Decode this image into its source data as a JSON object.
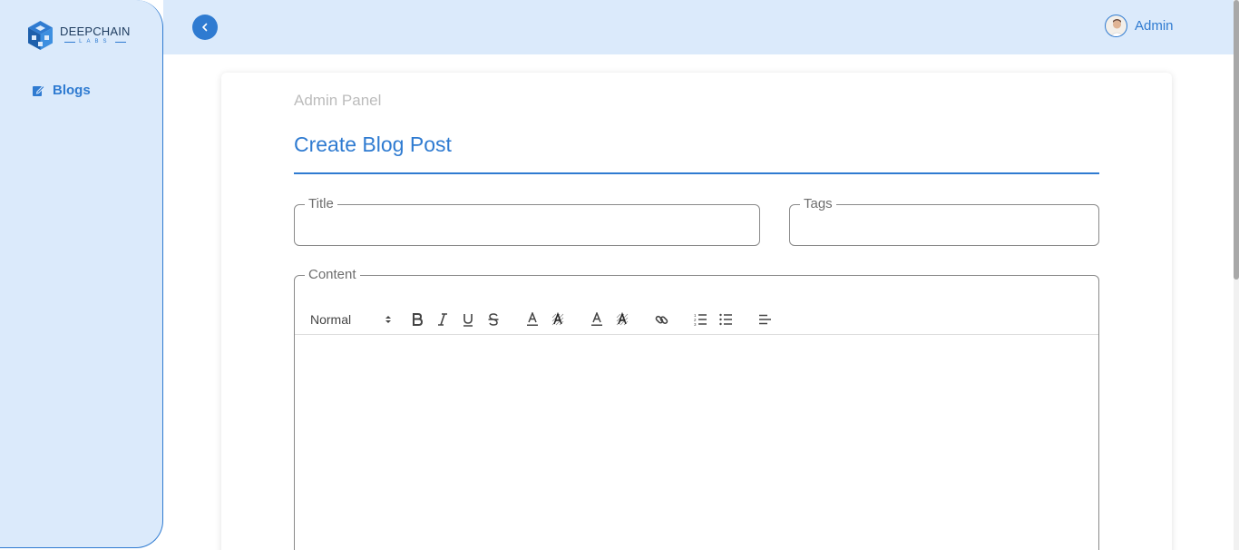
{
  "brand": {
    "name": "DEEPCHAIN",
    "sub": "LABS",
    "accent_color": "#2f7bd1",
    "panel_bg": "#dbeafb"
  },
  "sidebar": {
    "items": [
      {
        "label": "Blogs",
        "icon": "edit-square-icon"
      }
    ]
  },
  "header": {
    "back_icon": "chevron-left-icon",
    "user_name": "Admin"
  },
  "main": {
    "breadcrumb": "Admin Panel",
    "title": "Create Blog Post",
    "fields": {
      "title": {
        "label": "Title",
        "value": ""
      },
      "tags": {
        "label": "Tags",
        "value": ""
      },
      "content": {
        "label": "Content",
        "value": ""
      }
    },
    "toolbar": {
      "format_select": "Normal",
      "buttons": [
        "bold-icon",
        "italic-icon",
        "underline-icon",
        "strike-icon",
        "text-color-icon",
        "text-background-icon",
        "text-color-icon",
        "text-background-icon",
        "link-icon",
        "ordered-list-icon",
        "bullet-list-icon",
        "align-icon"
      ]
    }
  }
}
